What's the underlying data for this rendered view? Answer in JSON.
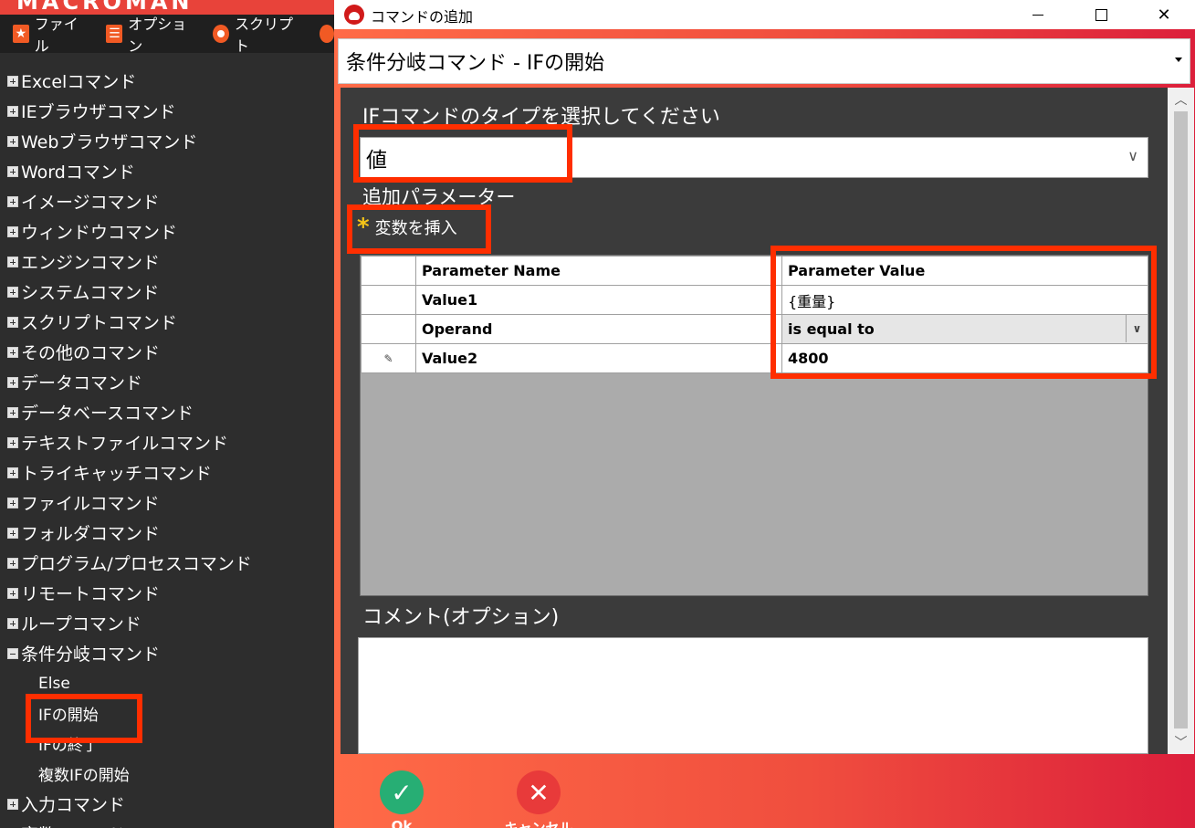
{
  "app": {
    "title_fragment": "MACROMAN",
    "menu": [
      {
        "label": "ファイル",
        "icon": "star-icon"
      },
      {
        "label": "オプション",
        "icon": "list-icon"
      },
      {
        "label": "スクリプト",
        "icon": "record-icon"
      }
    ],
    "tree": {
      "categories": [
        "Excelコマンド",
        "IEブラウザコマンド",
        "Webブラウザコマンド",
        "Wordコマンド",
        "イメージコマンド",
        "ウィンドウコマンド",
        "エンジンコマンド",
        "システムコマンド",
        "スクリプトコマンド",
        "その他のコマンド",
        "データコマンド",
        "データベースコマンド",
        "テキストファイルコマンド",
        "トライキャッチコマンド",
        "ファイルコマンド",
        "フォルダコマンド",
        "プログラム/プロセスコマンド",
        "リモートコマンド",
        "ループコマンド"
      ],
      "expanded": {
        "label": "条件分岐コマンド",
        "children": [
          "Else",
          "IFの開始",
          "IFの終了",
          "複数IFの開始"
        ]
      },
      "after": [
        "入力コマンド",
        "変数コマンド"
      ]
    }
  },
  "dialog": {
    "title": "コマンドの追加",
    "command": "条件分岐コマンド - IFの開始",
    "if_type_label": "IFコマンドのタイプを選択してください",
    "if_type_value": "値",
    "extra_params_label": "追加パラメーター",
    "insert_variable": "変数を挿入",
    "grid": {
      "headers": [
        "Parameter Name",
        "Parameter Value"
      ],
      "rows": [
        {
          "name": "Value1",
          "value": "{重量}"
        },
        {
          "name": "Operand",
          "value": "is equal to"
        },
        {
          "name": "Value2",
          "value": "4800"
        }
      ]
    },
    "comment_label": "コメント(オプション)",
    "comment_value": "",
    "buttons": {
      "ok": "Ok",
      "cancel": "キャンセル"
    }
  },
  "colors": {
    "highlight": "#ff2e00",
    "ok": "#27ae74",
    "cancel": "#e83a3a",
    "accent": "#f15a24"
  }
}
